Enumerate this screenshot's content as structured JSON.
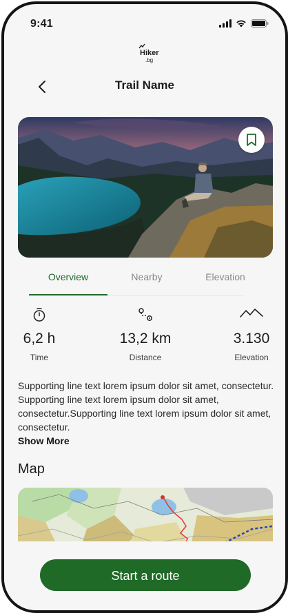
{
  "status_bar": {
    "time": "9:41"
  },
  "logo": {
    "text_top": "Hiker",
    "text_bottom": ".bg"
  },
  "header": {
    "title": "Trail Name"
  },
  "tabs": [
    {
      "label": "Overview",
      "active": true
    },
    {
      "label": "Nearby",
      "active": false
    },
    {
      "label": "Elevation",
      "active": false
    }
  ],
  "stats": {
    "time": {
      "value": "6,2 h",
      "label": "Time",
      "icon": "stopwatch-icon"
    },
    "distance": {
      "value": "13,2 km",
      "label": "Distance",
      "icon": "route-icon"
    },
    "elevation": {
      "value": "3.130",
      "label": "Elevation",
      "icon": "mountain-icon"
    }
  },
  "description": {
    "text": "Supporting line text lorem ipsum dolor sit amet, consectetur. Supporting line text lorem ipsum dolor sit amet, consectetur.Supporting line text lorem ipsum dolor sit amet, consectetur.",
    "show_more": "Show More"
  },
  "map": {
    "title": "Map"
  },
  "cta": {
    "label": "Start a route"
  },
  "colors": {
    "accent": "#1e6a2a",
    "button": "#1f6a26",
    "background": "#f6f6f6"
  }
}
